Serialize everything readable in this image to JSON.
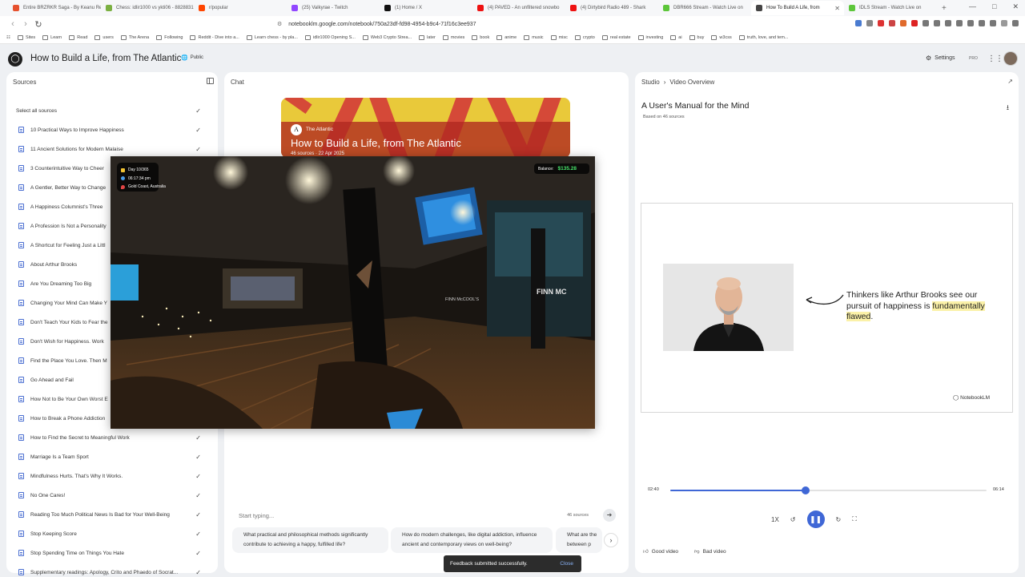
{
  "browser": {
    "tabs": [
      {
        "title": "Entire BRZRKR Saga - By Keanu Re",
        "color": "#e6512e",
        "active": false
      },
      {
        "title": "Chess: idlir1000 vs ykti06 - 8828831",
        "color": "#7bb042",
        "active": false
      },
      {
        "title": "r/popular",
        "color": "#ff4500",
        "active": false
      },
      {
        "title": "(25) Valkyrae - Twitch",
        "color": "#9146ff",
        "active": false
      },
      {
        "title": "(1) Home / X",
        "color": "#111111",
        "active": false
      },
      {
        "title": "(4) PAVED - An unfiltered snowbo",
        "color": "#e11",
        "active": false
      },
      {
        "title": "(4) Dirtybird Radio 489 - Shark",
        "color": "#e11",
        "active": false
      },
      {
        "title": "DBR666 Stream - Watch Live on",
        "color": "#5cc63a",
        "active": false
      },
      {
        "title": "How To Build A Life, from",
        "color": "#444",
        "active": true
      },
      {
        "title": "IDLS Stream - Watch Live on",
        "color": "#5cc63a",
        "active": false
      }
    ],
    "new_tab": "+",
    "url": "notebooklm.google.com/notebook/750a23df-fd98-4954-b9c4-71f16c3ee937",
    "bookmarks": [
      "Sites",
      "Learn",
      "Read",
      "users",
      "The Arena",
      "Following",
      "Reddit - Dive into a...",
      "Learn chess - by pla...",
      "idlir1000 Opening S...",
      "Web3 Crypto Strea...",
      "later",
      "movies",
      "book",
      "anime",
      "music",
      "misc",
      "crypto",
      "real estate",
      "investing",
      "ai",
      "buy",
      "w3css",
      "truth, love, and tem..."
    ]
  },
  "header": {
    "title": "How to Build a Life, from The Atlantic",
    "visibility": "Public",
    "settings_label": "Settings",
    "plan_badge": "PRO"
  },
  "sources": {
    "title": "Sources",
    "select_all": "Select all sources",
    "items": [
      "10 Practical Ways to Improve Happiness",
      "11 Ancient Solutions for Modern Malaise",
      "3 Counterintuitive Way to Cheer",
      "A Gentler, Better Way to Change",
      "A Happiness Columnist's Three",
      "A Profession Is Not a Personality",
      "A Shortcut for Feeling Just a Littl",
      "About Arthur Brooks",
      "Are You Dreaming Too Big",
      "Changing Your Mind Can Make Y",
      "Don't Teach Your Kids to Fear the",
      "Don't Wish for Happiness. Work",
      "Find the Place You Love. Then M",
      "Go Ahead and Fail",
      "How Not to Be Your Own Worst E",
      "How to Break a Phone Addiction",
      "How to Find the Secret to Meaningful Work",
      "Marriage Is a Team Sport",
      "Mindfulness Hurts. That's Why It Works.",
      "No One Cares!",
      "Reading Too Much Political News Is Bad for Your Well-Being",
      "Stop Keeping Score",
      "Stop Spending Time on Things You Hate",
      "Supplementary readings: Apology, Crito and Phaedo of Socrat..."
    ]
  },
  "chat": {
    "title": "Chat",
    "hero": {
      "source_name": "The Atlantic",
      "title": "How to Build a Life, from The Atlantic",
      "meta": "46 sources · 22 Apr 2025"
    },
    "input_placeholder": "Start typing...",
    "source_count": "46 sources",
    "suggestions": [
      "What practical and philosophical methods significantly contribute to achieving a happy, fulfilled life?",
      "How do modern challenges, like digital addiction, influence ancient and contemporary views on well-being?",
      "What are the between p"
    ]
  },
  "studio": {
    "crumb_root": "Studio",
    "crumb_current": "Video Overview",
    "video_title": "A User's Manual for the Mind",
    "video_subtitle": "Based on 46 sources",
    "slide": {
      "text_before": "Thinkers like Arthur Brooks see our pursuit of happiness is ",
      "text_highlight": "fundamentally flawed",
      "text_after": ".",
      "brand": "NotebookLM"
    },
    "current_time": "02:40",
    "duration": "06:14",
    "progress": 0.428,
    "speed": "1X",
    "good_label": "Good video",
    "bad_label": "Bad video"
  },
  "overlay": {
    "day": "Day 10/365",
    "time": "06:17:34 pm",
    "location": "Gold Coast, Australia",
    "balance_label": "Balance:",
    "balance_value": "$135.28",
    "sign_text_1": "FINN MC",
    "sign_text_2": "FINN McCOOL'S"
  },
  "toast": {
    "message": "Feedback submitted successfully.",
    "close_label": "Close"
  }
}
